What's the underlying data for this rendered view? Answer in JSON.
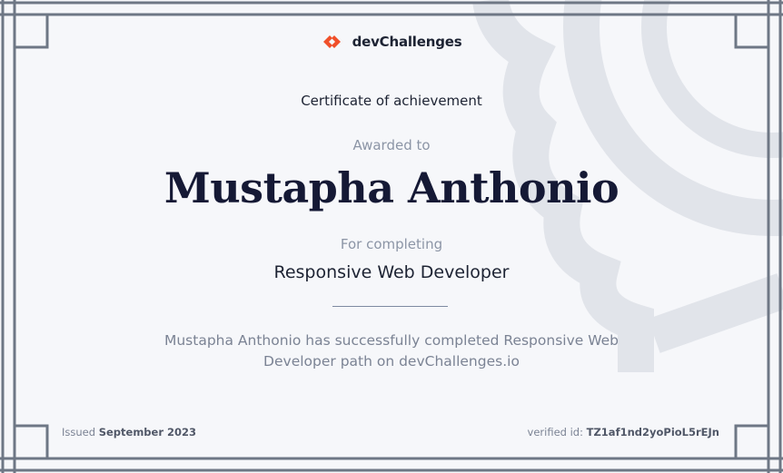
{
  "brand": {
    "name": "devChallenges",
    "logo_color": "#f0502a",
    "icon": "devchallenges-logo-icon"
  },
  "certificate": {
    "title": "Certificate of achievement",
    "awarded_label": "Awarded to",
    "recipient": "Mustapha Anthonio",
    "completing_label": "For completing",
    "course": "Responsive Web Developer",
    "description": "Mustapha Anthonio has successfully completed Responsive Web Developer path on devChallenges.io"
  },
  "footer": {
    "issued_prefix": "Issued",
    "issued_date": "September 2023",
    "verified_prefix": "verified id:",
    "verified_id": "TZ1af1nd2yoPioL5rEJn"
  },
  "colors": {
    "background": "#f6f7fa",
    "frame": "#6e7785",
    "seal": "#e1e4ea",
    "text_primary": "#1d2333",
    "text_muted": "#8c95a6"
  }
}
